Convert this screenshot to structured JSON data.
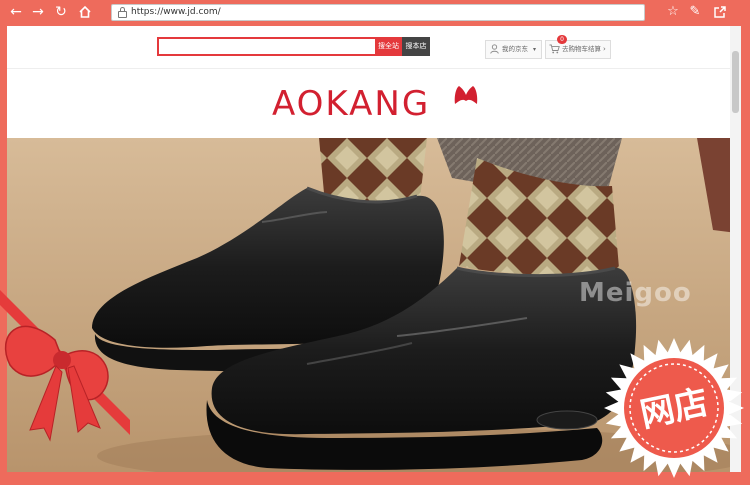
{
  "browser": {
    "url": "https://www.jd.com/",
    "icons": [
      "back-arrow-icon",
      "forward-arrow-icon",
      "refresh-icon",
      "home-icon",
      "lock-icon",
      "star-icon",
      "edit-icon",
      "share-icon"
    ]
  },
  "header": {
    "search_all_label": "搜全站",
    "search_store_label": "搜本店",
    "my_jd_label": "我的京东",
    "cart_label": "去购物车结算",
    "cart_count": "0"
  },
  "store": {
    "logo_text": "AOKANG"
  },
  "banner": {
    "watermark": "Meigoo"
  },
  "frame": {
    "badge_text": "网店"
  },
  "colors": {
    "frame": "#ee6b5c",
    "brand_red": "#e4393c",
    "logo_red": "#d22030",
    "banner_bg": "#c9a985"
  }
}
